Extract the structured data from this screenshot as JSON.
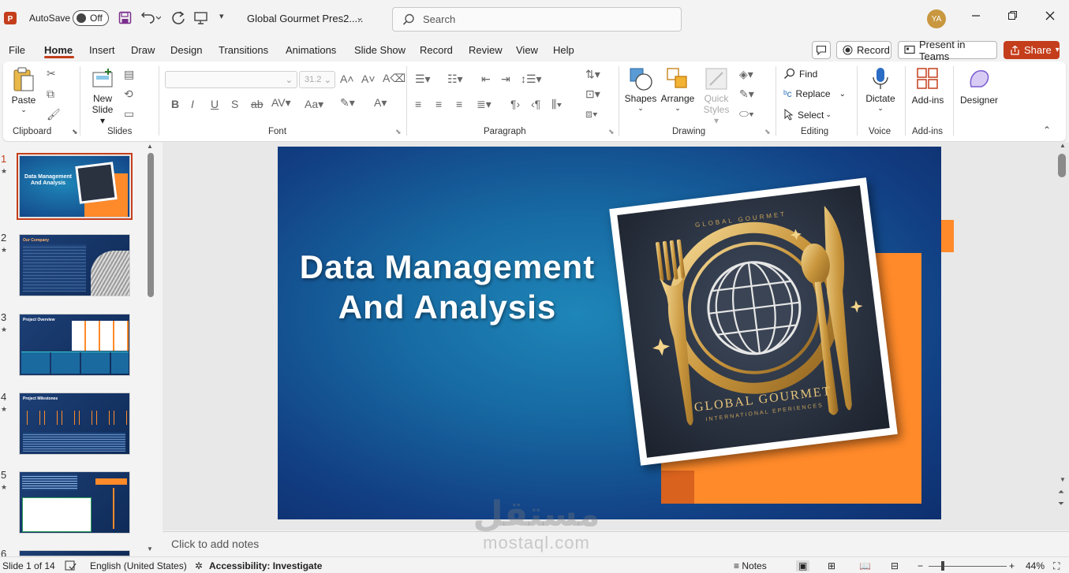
{
  "titlebar": {
    "autosave_label": "AutoSave",
    "autosave_state": "Off",
    "doc_title": "Global Gourmet Pres2.....",
    "search_placeholder": "Search",
    "avatar_initials": "YA"
  },
  "menu": {
    "tabs": [
      "File",
      "Home",
      "Insert",
      "Draw",
      "Design",
      "Transitions",
      "Animations",
      "Slide Show",
      "Record",
      "Review",
      "View",
      "Help"
    ],
    "active": "Home",
    "record_label": "Record",
    "present_label": "Present in Teams",
    "share_label": "Share"
  },
  "ribbon": {
    "groups": {
      "clipboard": "Clipboard",
      "slides": "Slides",
      "font": "Font",
      "paragraph": "Paragraph",
      "drawing": "Drawing",
      "editing": "Editing",
      "voice": "Voice",
      "addins": "Add-ins"
    },
    "paste": "Paste",
    "new_slide": "New",
    "new_slide2": "Slide",
    "font_size": "31.2",
    "shapes": "Shapes",
    "arrange": "Arrange",
    "quick": "Quick",
    "styles": "Styles",
    "find": "Find",
    "replace": "Replace",
    "select": "Select",
    "dictate": "Dictate",
    "addins_btn": "Add-ins",
    "designer": "Designer"
  },
  "thumbnails": [
    {
      "num": "1",
      "title": "Data Management And Analysis",
      "selected": true
    },
    {
      "num": "2",
      "title": "Our Company"
    },
    {
      "num": "3",
      "title": "Project Overview"
    },
    {
      "num": "4",
      "title": "Project Milestones"
    },
    {
      "num": "5",
      "title": ""
    },
    {
      "num": "6",
      "title": ""
    }
  ],
  "slide": {
    "title_line1": "Data Management",
    "title_line2": "And Analysis",
    "logo_top": "GLOBAL GOURMET",
    "logo_main": "GLOBAL GOURMET",
    "logo_sub": "INTERNATIONAL EPERIENCES",
    "accent": "#ff8a2a"
  },
  "notes_placeholder": "Click to add notes",
  "status": {
    "slide_info": "Slide 1 of 14",
    "language": "English (United States)",
    "accessibility": "Accessibility: Investigate",
    "notes": "Notes",
    "zoom": "44%"
  },
  "watermark": {
    "arabic": "مستقل",
    "latin": "mostaql.com"
  }
}
